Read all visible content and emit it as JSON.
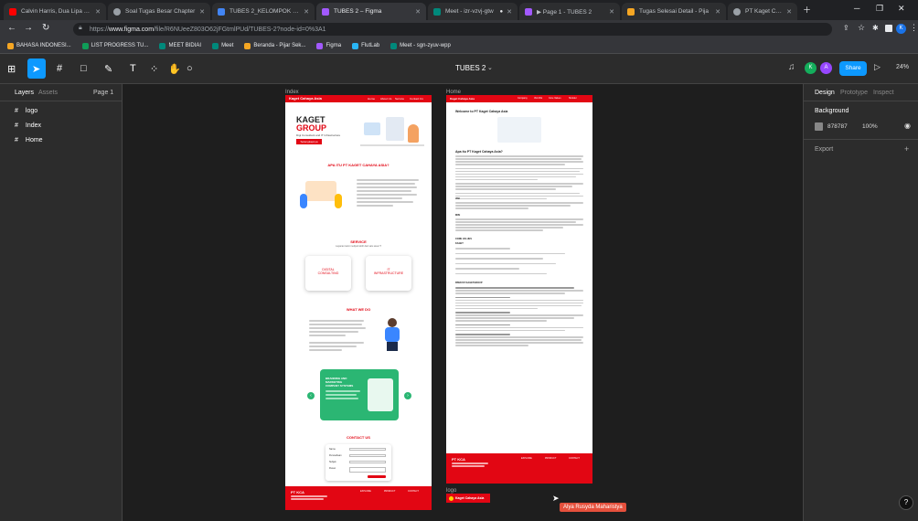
{
  "tabs": [
    {
      "title": "Calvin Harris, Dua Lipa - O",
      "color": "#ff0000"
    },
    {
      "title": "Soal Tugas Besar Chapter",
      "color": "#9aa0a6"
    },
    {
      "title": "TUBES 2_KELOMPOK 3 - G",
      "color": "#4285f4"
    },
    {
      "title": "TUBES 2 – Figma",
      "color": "#a259ff"
    },
    {
      "title": "Meet - izr-vzvj-gtw",
      "color": "#00897b"
    },
    {
      "title": "▶ Page 1 - TUBES 2",
      "color": "#a259ff"
    },
    {
      "title": "Tugas Selesai Detail - Pija",
      "color": "#f5a623"
    },
    {
      "title": "PT Kaget Cahaya Asia",
      "color": "#9aa0a6"
    }
  ],
  "url_prefix": "https://",
  "url_host": "www.figma.com",
  "url_path": "/file/R6NUeeZ803O62jFGtmlPUd/TUBES-2?node-id=0%3A1",
  "bookmarks": [
    {
      "label": "BAHASA INDONESI...",
      "color": "#f5a623"
    },
    {
      "label": "LIST PROGRESS TU...",
      "color": "#0f9d58"
    },
    {
      "label": "MEET BIDIAI",
      "color": "#00897b"
    },
    {
      "label": "Meet",
      "color": "#00897b"
    },
    {
      "label": "Beranda - Pijar Sek...",
      "color": "#f5a623"
    },
    {
      "label": "Figma",
      "color": "#a259ff"
    },
    {
      "label": "FlutLab",
      "color": "#29b6f6"
    },
    {
      "label": "Meet - sgn-zyuv-wpp",
      "color": "#00897b"
    }
  ],
  "file_title": "TUBES 2",
  "share_label": "Share",
  "zoom": "24%",
  "avatars": [
    "K",
    "A"
  ],
  "left_tabs": {
    "layers": "Layers",
    "assets": "Assets",
    "page": "Page 1"
  },
  "layers": [
    "logo",
    "Index",
    "Home"
  ],
  "right_tabs": {
    "design": "Design",
    "prototype": "Prototype",
    "inspect": "Inspect"
  },
  "background": {
    "label": "Background",
    "hex": "878787",
    "opacity": "100%",
    "swatch": "#878787"
  },
  "export_label": "Export",
  "frames": {
    "index": "Index",
    "home": "Home",
    "logo": "logo"
  },
  "collab_name": "Alya Rusyda Maharistya",
  "site": {
    "logo_text": "Kaget Cahaya Asia",
    "nav": [
      "Home",
      "About Us",
      "Service",
      "Contact Us"
    ],
    "home_nav": [
      "Company",
      "Visi Misi",
      "Core Values",
      "Struktur"
    ],
    "hero_title1": "KAGET",
    "hero_title2": "GROUP",
    "hero_sub": "Digi Consultant and IT Infrastructure",
    "hero_btn": "Selengkapnya",
    "about_title": "APA ITU PT KAGET CAHAYA ASIA?",
    "service_title": "SERVICE",
    "service_sub": "Layanan kami meliputi lebih dari satu area IT",
    "svc1a": "DIGITAL",
    "svc1b": "CONSULTING",
    "svc2a": "IT",
    "svc2b": "INFRASTRUCTURE",
    "whatwedo": "WHAT WE DO",
    "green_card1": "BRANDING AND",
    "green_card2": "MARKETING",
    "green_card3": "COMPANY SYSTEMS",
    "contact_title": "CONTACT US",
    "contact_fields": [
      "Nama",
      "Perusahaan",
      "Subjek",
      "Pesan"
    ],
    "footer_brand": "PT KCA",
    "footer_cols": [
      "EXPLORE",
      "PRODUCT",
      "CONTACT"
    ],
    "home_welcome": "Welcome to PT Kaget Cahaya Asia",
    "home_q": "Apa itu PT Kaget Cahaya Asia?",
    "home_h_visi": "VISI",
    "home_h_misi": "MISI",
    "home_h_core": "CORE VALUES",
    "home_h_kaget": "KAGET",
    "home_h_sejarah": "RIWAYAT KAGETGROUP"
  }
}
